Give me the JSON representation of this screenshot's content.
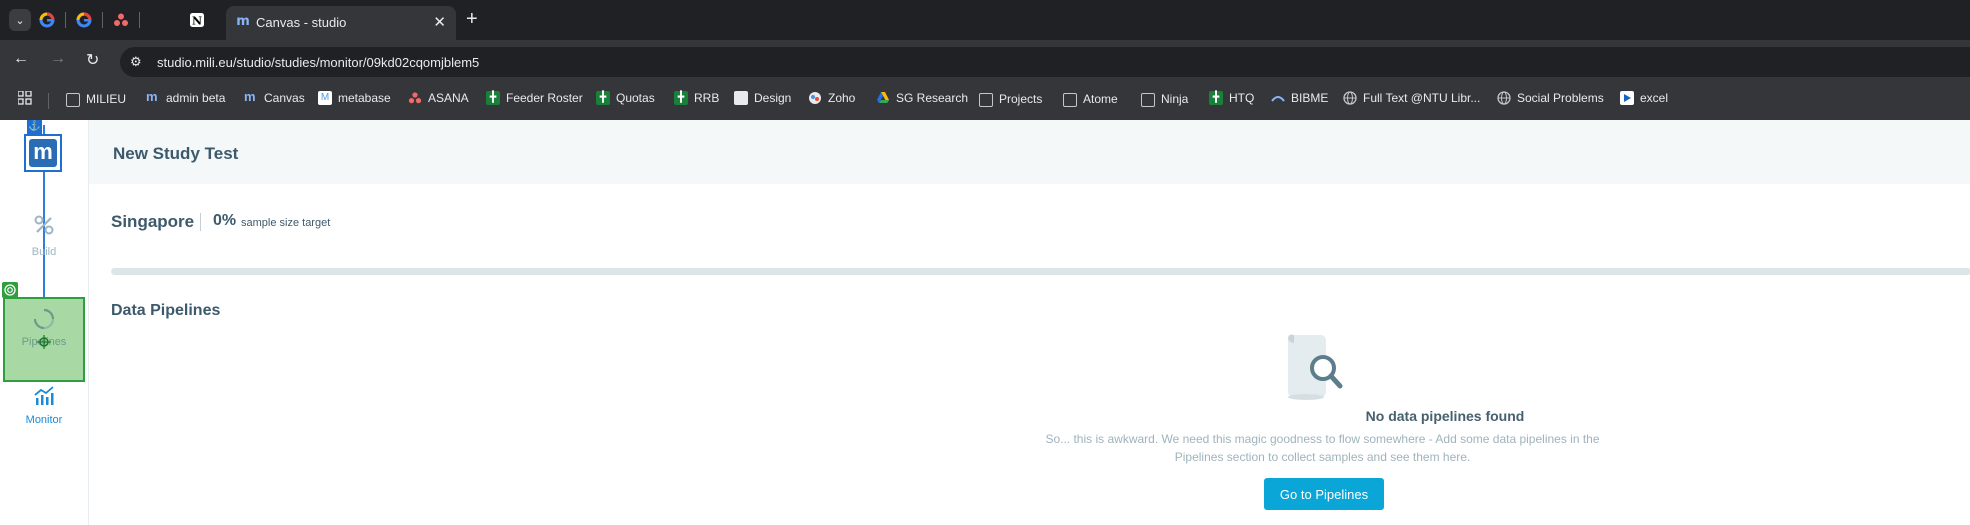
{
  "browser": {
    "tabs": [
      {
        "icon": "google-icon"
      },
      {
        "icon": "google-icon"
      },
      {
        "icon": "asana-icon"
      },
      {
        "icon": "notion-icon"
      }
    ],
    "active_tab": {
      "title": "Canvas - studio",
      "icon": "mili-icon"
    },
    "new_tab_symbol": "+",
    "url": "studio.mili.eu/studio/studies/monitor/09kd02cqomjblem5",
    "bookmarks": [
      {
        "label": "MILIEU",
        "icon": "folder-icon"
      },
      {
        "label": "admin beta",
        "icon": "mili-icon"
      },
      {
        "label": "Canvas",
        "icon": "mili-icon"
      },
      {
        "label": "metabase",
        "icon": "metabase-icon"
      },
      {
        "label": "ASANA",
        "icon": "asana-icon"
      },
      {
        "label": "Feeder Roster",
        "icon": "sheets-icon"
      },
      {
        "label": "Quotas",
        "icon": "sheets-icon"
      },
      {
        "label": "RRB",
        "icon": "sheets-icon"
      },
      {
        "label": "Design",
        "icon": "design-icon"
      },
      {
        "label": "Zoho",
        "icon": "zoho-icon"
      },
      {
        "label": "SG Research",
        "icon": "drive-icon"
      },
      {
        "label": "Projects",
        "icon": "folder-icon"
      },
      {
        "label": "Atome",
        "icon": "folder-icon"
      },
      {
        "label": "Ninja",
        "icon": "folder-icon"
      },
      {
        "label": "HTQ",
        "icon": "sheets-icon"
      },
      {
        "label": "BIBME",
        "icon": "bibme-icon"
      },
      {
        "label": "Full Text @NTU Libr...",
        "icon": "globe-icon"
      },
      {
        "label": "Social Problems",
        "icon": "globe-icon"
      },
      {
        "label": "excel",
        "icon": "excel-icon"
      }
    ]
  },
  "sidebar": {
    "logo_letter": "m",
    "items": [
      {
        "label": "Build",
        "icon": "build-icon"
      },
      {
        "label": "Pipelines",
        "icon": "pipelines-icon"
      },
      {
        "label": "Monitor",
        "icon": "monitor-icon"
      }
    ]
  },
  "main": {
    "study_title": "New Study Test",
    "country": "Singapore",
    "percent": "0%",
    "percent_label": "sample size target",
    "progress": 0,
    "section_title": "Data Pipelines",
    "empty_state": {
      "title": "No data pipelines found",
      "description": "So... this is awkward. We need this magic goodness to flow somewhere - Add some data pipelines in the Pipelines section to collect samples and see them here.",
      "button_label": "Go to Pipelines"
    }
  },
  "colors": {
    "accent": "#0aa6d8",
    "text": "#3d5a6c",
    "highlight_green": "#2e9e3e"
  }
}
